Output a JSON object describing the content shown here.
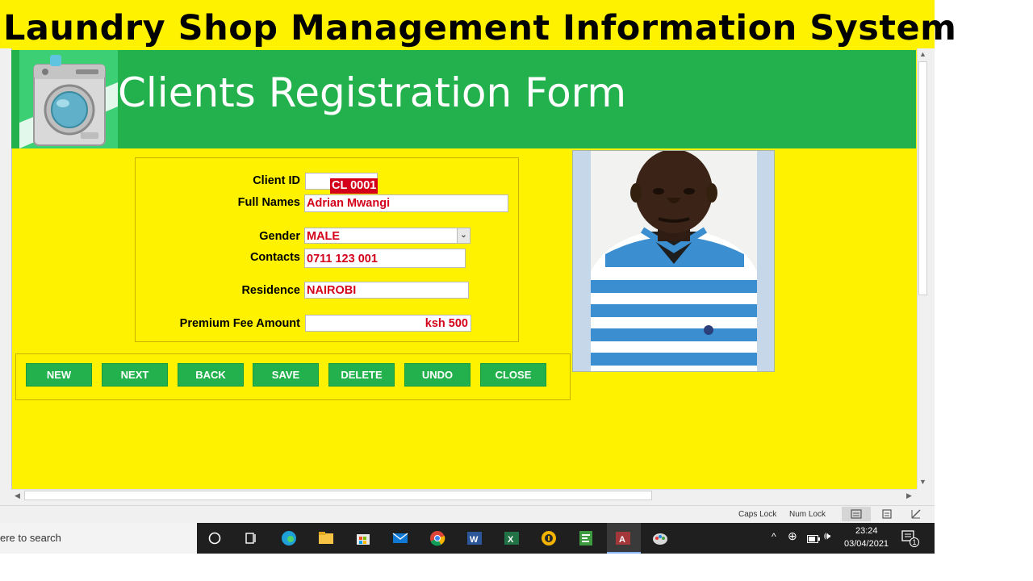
{
  "banner": {
    "title": "Laundry Shop Management Information System"
  },
  "form": {
    "title": "Clients Registration Form",
    "fields": {
      "client_id": {
        "label": "Client ID",
        "value": "CL 0001"
      },
      "full_names": {
        "label": "Full Names",
        "value": "Adrian Mwangi"
      },
      "gender": {
        "label": "Gender",
        "value": "MALE"
      },
      "contacts": {
        "label": "Contacts",
        "value": "0711 123 001"
      },
      "residence": {
        "label": "Residence",
        "value": "NAIROBI"
      },
      "premium_fee": {
        "label": "Premium Fee Amount",
        "value": "ksh 500"
      }
    },
    "buttons": {
      "new": "NEW",
      "next": "NEXT",
      "back": "BACK",
      "save": "SAVE",
      "delete": "DELETE",
      "undo": "UNDO",
      "close": "CLOSE"
    }
  },
  "statusbar": {
    "caps_lock": "Caps Lock",
    "num_lock": "Num Lock"
  },
  "taskbar": {
    "search_text": "ere to search",
    "time": "23:24",
    "date": "03/04/2021",
    "notification_count": "1",
    "apps": [
      "cortana-icon",
      "task-view-icon",
      "edge-icon",
      "file-explorer-icon",
      "store-icon",
      "mail-icon",
      "chrome-icon",
      "word-icon",
      "excel-icon",
      "vpn-icon",
      "project-icon",
      "access-icon",
      "paint-icon"
    ]
  },
  "colors": {
    "banner_bg": "#fff200",
    "header_green": "#22b14c",
    "value_red": "#d4001a",
    "form_bg": "#fff200"
  }
}
